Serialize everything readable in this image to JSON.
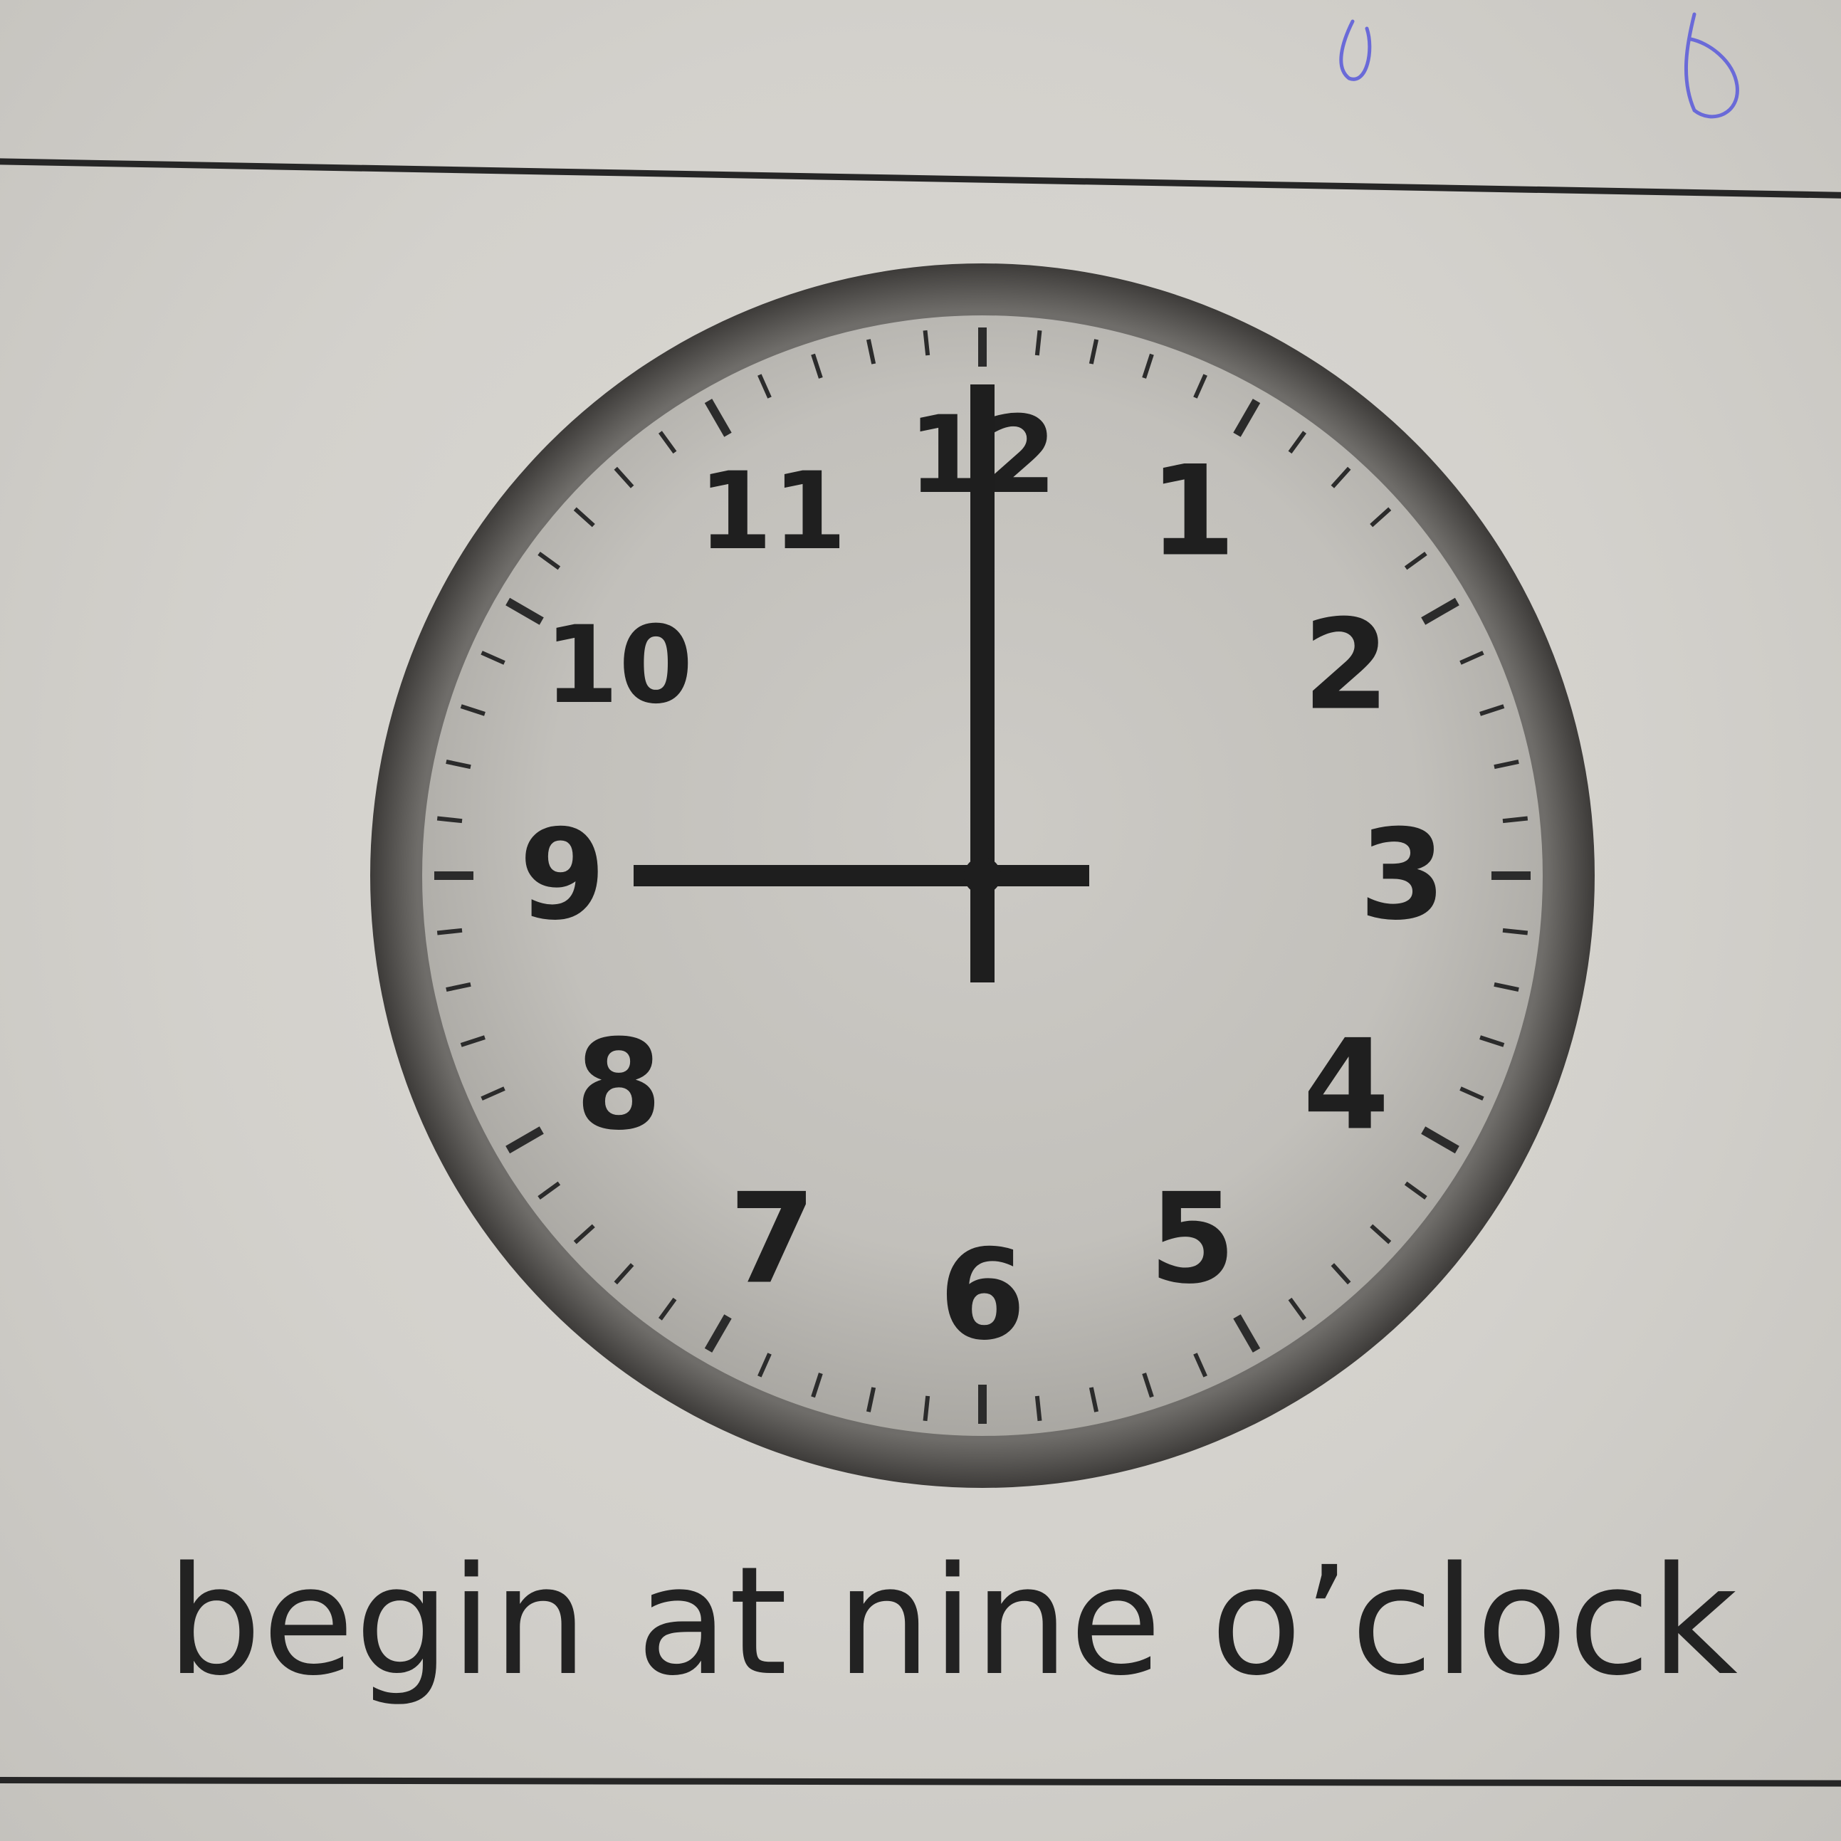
{
  "caption": "begin at nine o’clock",
  "clock": {
    "numerals": [
      "12",
      "1",
      "2",
      "3",
      "4",
      "5",
      "6",
      "7",
      "8",
      "9",
      "10",
      "11"
    ],
    "time_shown": {
      "hour": 9,
      "minute": 0
    }
  },
  "colors": {
    "paper": "#d6d4cf",
    "ink": "#262626",
    "clock_face": "#c9c7c2",
    "pen_ink": "#6a6ad8"
  }
}
